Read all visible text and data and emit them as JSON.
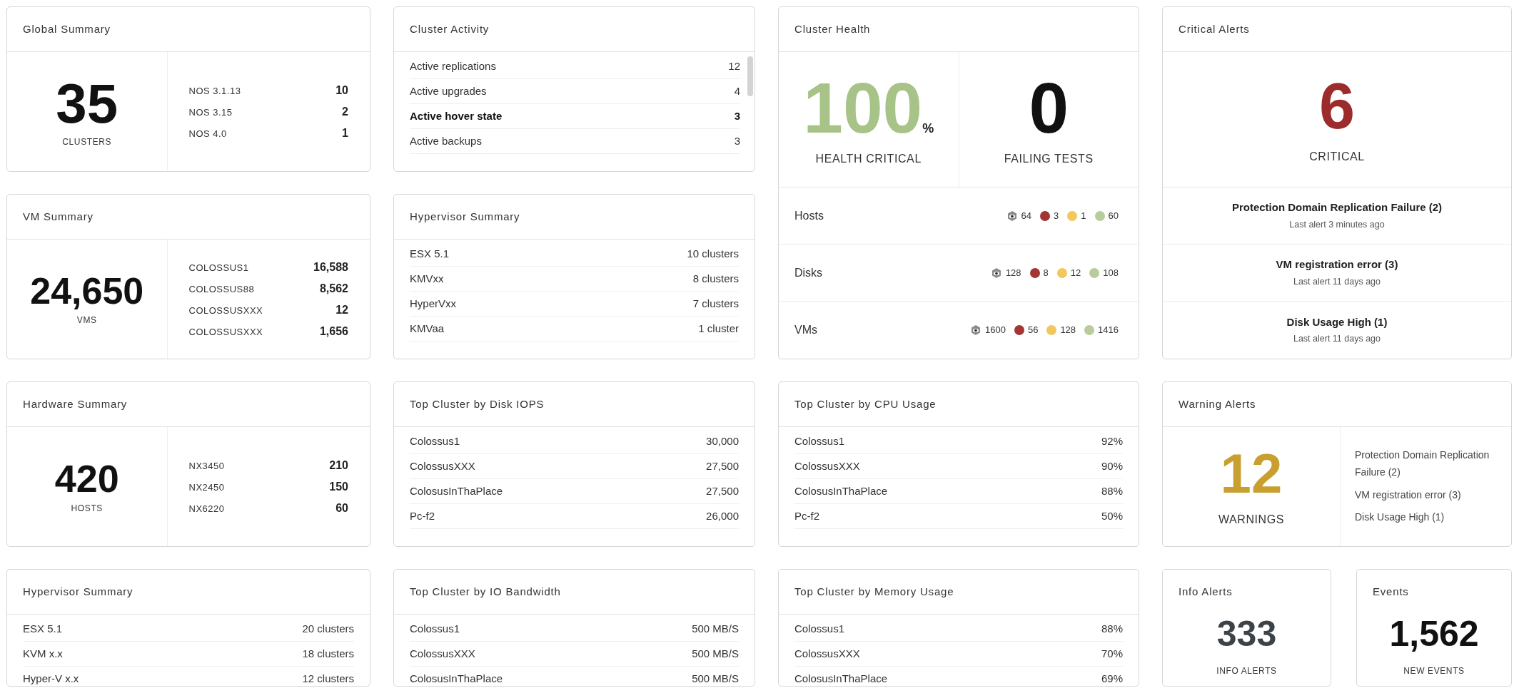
{
  "columns": [
    {
      "panels": [
        {
          "kind": "summary",
          "title": "Global Summary",
          "total": "35",
          "unit": "CLUSTERS",
          "breakdown": [
            {
              "label": "NOS 3.1.13",
              "value": "10"
            },
            {
              "label": "NOS 3.15",
              "value": "2"
            },
            {
              "label": "NOS 4.0",
              "value": "1"
            }
          ]
        },
        {
          "kind": "summary",
          "title": "VM Summary",
          "total": "24,650",
          "unit": "VMS",
          "breakdown": [
            {
              "label": "COLOSSUS1",
              "value": "16,588"
            },
            {
              "label": "COLOSSUS88",
              "value": "8,562"
            },
            {
              "label": "COLOSSUSXXX",
              "value": "12"
            },
            {
              "label": "COLOSSUSXXX",
              "value": "1,656"
            }
          ]
        },
        {
          "kind": "summary",
          "title": "Hardware Summary",
          "total": "420",
          "unit": "HOSTS",
          "breakdown": [
            {
              "label": "NX3450",
              "value": "210"
            },
            {
              "label": "NX2450",
              "value": "150"
            },
            {
              "label": "NX6220",
              "value": "60"
            }
          ]
        },
        {
          "kind": "list",
          "title": "Hypervisor Summary",
          "rows": [
            {
              "label": "ESX 5.1",
              "value": "20 clusters"
            },
            {
              "label": "KVM x.x",
              "value": "18 clusters"
            },
            {
              "label": "Hyper-V x.x",
              "value": "12 clusters"
            }
          ]
        }
      ]
    },
    {
      "panels": [
        {
          "kind": "activity",
          "title": "Cluster Activity",
          "rows": [
            {
              "label": "Active replications",
              "value": "12",
              "hovered": false
            },
            {
              "label": "Active upgrades",
              "value": "4",
              "hovered": false
            },
            {
              "label": "Active hover state",
              "value": "3",
              "hovered": true
            },
            {
              "label": "Active backups",
              "value": "3",
              "hovered": false
            }
          ]
        },
        {
          "kind": "list",
          "title": "Hypervisor Summary",
          "rows": [
            {
              "label": "ESX 5.1",
              "value": "10 clusters"
            },
            {
              "label": "KMVxx",
              "value": "8 clusters"
            },
            {
              "label": "HyperVxx",
              "value": "7 clusters"
            },
            {
              "label": "KMVaa",
              "value": "1 cluster"
            }
          ]
        },
        {
          "kind": "list",
          "title": "Top Cluster by Disk IOPS",
          "rows": [
            {
              "label": "Colossus1",
              "value": "30,000"
            },
            {
              "label": "ColossusXXX",
              "value": "27,500"
            },
            {
              "label": "ColosusInThaPlace",
              "value": "27,500"
            },
            {
              "label": "Pc-f2",
              "value": "26,000"
            }
          ]
        },
        {
          "kind": "list",
          "title": "Top Cluster by IO Bandwidth",
          "rows": [
            {
              "label": "Colossus1",
              "value": "500 MB/S"
            },
            {
              "label": "ColossusXXX",
              "value": "500 MB/S"
            },
            {
              "label": "ColosusInThaPlace",
              "value": "500 MB/S"
            }
          ]
        }
      ]
    },
    {
      "panels": [
        {
          "kind": "health",
          "title": "Cluster Health",
          "metrics": [
            {
              "value": "100",
              "unit": "%",
              "label": "HEALTH CRITICAL",
              "color": "#a7c388"
            },
            {
              "value": "0",
              "label": "FAILING TESTS",
              "color": "#111111"
            }
          ],
          "rows": [
            {
              "label": "Hosts",
              "counts": [
                {
                  "kind": "total",
                  "value": "64"
                },
                {
                  "kind": "dot",
                  "color": "#a33535",
                  "value": "3"
                },
                {
                  "kind": "dot",
                  "color": "#f2c75c",
                  "value": "1"
                },
                {
                  "kind": "dot",
                  "color": "#b8cc9c",
                  "value": "60"
                }
              ]
            },
            {
              "label": "Disks",
              "counts": [
                {
                  "kind": "total",
                  "value": "128"
                },
                {
                  "kind": "dot",
                  "color": "#a33535",
                  "value": "8"
                },
                {
                  "kind": "dot",
                  "color": "#f2c75c",
                  "value": "12"
                },
                {
                  "kind": "dot",
                  "color": "#b8cc9c",
                  "value": "108"
                }
              ]
            },
            {
              "label": "VMs",
              "counts": [
                {
                  "kind": "total",
                  "value": "1600"
                },
                {
                  "kind": "dot",
                  "color": "#a33535",
                  "value": "56"
                },
                {
                  "kind": "dot",
                  "color": "#f2c75c",
                  "value": "128"
                },
                {
                  "kind": "dot",
                  "color": "#b8cc9c",
                  "value": "1416"
                }
              ]
            }
          ]
        },
        {
          "kind": "list",
          "title": "Top Cluster by CPU Usage",
          "rows": [
            {
              "label": "Colossus1",
              "value": "92%"
            },
            {
              "label": "ColossusXXX",
              "value": "90%"
            },
            {
              "label": "ColosusInThaPlace",
              "value": "88%"
            },
            {
              "label": "Pc-f2",
              "value": "50%"
            }
          ]
        },
        {
          "kind": "list",
          "title": "Top Cluster by Memory Usage",
          "rows": [
            {
              "label": "Colossus1",
              "value": "88%"
            },
            {
              "label": "ColossusXXX",
              "value": "70%"
            },
            {
              "label": "ColosusInThaPlace",
              "value": "69%"
            }
          ]
        }
      ]
    },
    {
      "panels": [
        {
          "kind": "critical",
          "title": "Critical Alerts",
          "count": "6",
          "color": "#9c2b2b",
          "label": "CRITICAL",
          "alerts": [
            {
              "name": "Protection Domain Replication Failure (2)",
              "time": "Last alert 3 minutes ago"
            },
            {
              "name": "VM registration error (3)",
              "time": "Last alert 11 days ago"
            },
            {
              "name": "Disk Usage High (1)",
              "time": "Last alert 11 days ago"
            }
          ]
        },
        {
          "kind": "warning",
          "title": "Warning Alerts",
          "count": "12",
          "color": "#c9a030",
          "label": "WARNINGS",
          "alerts": [
            "Protection Domain Replication Failure (2)",
            "VM registration error (3)",
            "Disk Usage High (1)"
          ]
        },
        {
          "kind": "pair",
          "panels": [
            {
              "kind": "counter",
              "title": "Info Alerts",
              "count": "333",
              "color": "#3b4248",
              "label": "INFO ALERTS"
            },
            {
              "kind": "counter",
              "title": "Events",
              "count": "1,562",
              "color": "#111111",
              "label": "NEW EVENTS"
            }
          ]
        }
      ]
    }
  ]
}
